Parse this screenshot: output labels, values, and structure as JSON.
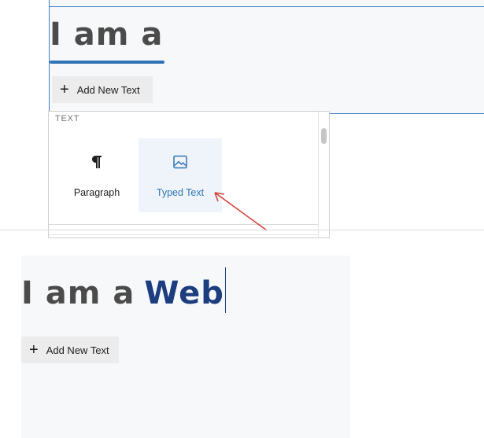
{
  "top_editor": {
    "heading": "I am a",
    "add_button_label": "Add New Text"
  },
  "inserter": {
    "category_label": "TEXT",
    "blocks": [
      {
        "label": "Paragraph",
        "icon": "pilcrow-icon"
      },
      {
        "label": "Typed Text",
        "icon": "image-icon",
        "highlighted": true
      }
    ]
  },
  "result_editor": {
    "heading_static": "I am a",
    "heading_typed": "Web",
    "add_button_label": "Add New Text"
  },
  "colors": {
    "accent": "#2f74b5",
    "typed_text": "#1c3d7e",
    "annotation_arrow": "#d0453e"
  }
}
